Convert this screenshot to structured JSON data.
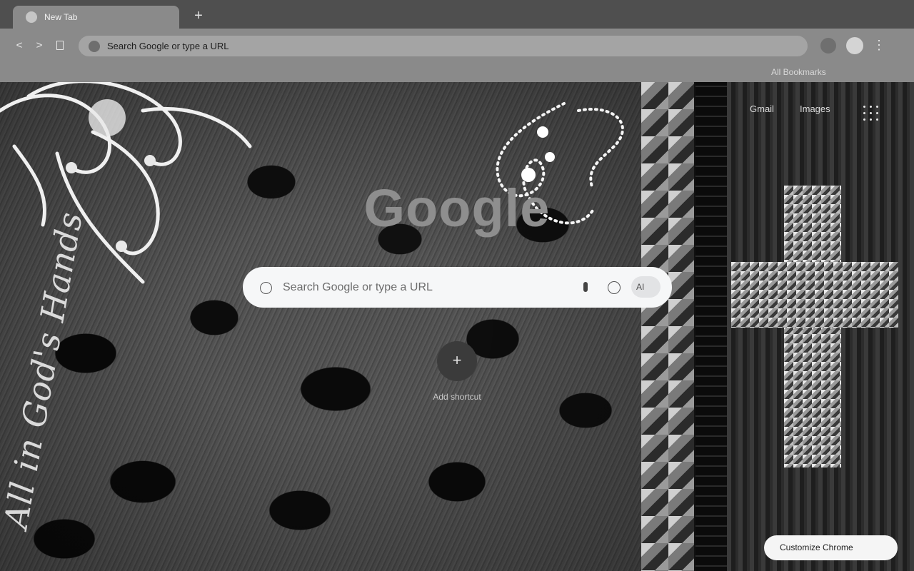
{
  "tabs": [
    {
      "title": "New Tab",
      "icon": "globe-icon"
    }
  ],
  "new_tab_glyph": "+",
  "toolbar": {
    "back_glyph": "<",
    "forward_glyph": ">",
    "omnibox_text": "Search Google or type a URL",
    "menu_glyph": "⋮"
  },
  "bookmarks": {
    "all_label": "All Bookmarks"
  },
  "ntp": {
    "gmail": "Gmail",
    "images": "Images",
    "logo": "Google",
    "search_placeholder": "Search Google or type a URL",
    "ai_label": "AI",
    "shortcut_glyph": "+",
    "add_shortcut": "Add shortcut",
    "customize": "Customize Chrome"
  },
  "wallpaper": {
    "script_text": "All in God's Hands"
  },
  "colors": {
    "tabstrip": "#4f4f4f",
    "toolbar": "#8a8a8a",
    "searchbox": "#f6f7f8"
  }
}
